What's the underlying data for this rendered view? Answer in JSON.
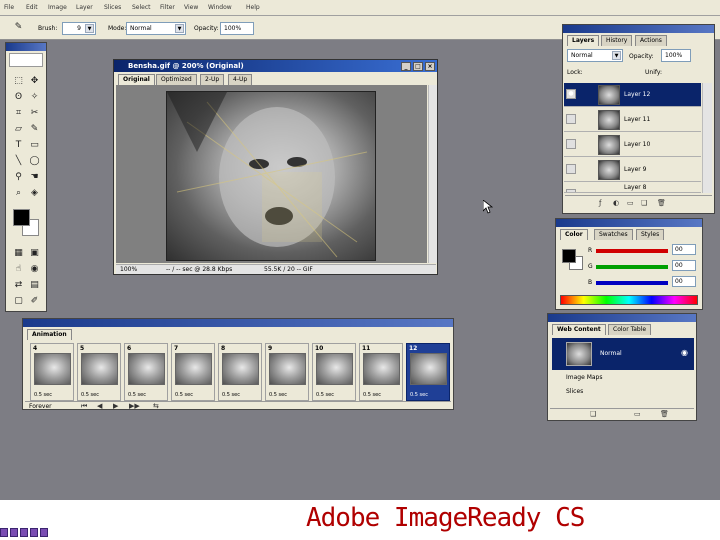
{
  "menu": [
    "File",
    "Edit",
    "Image",
    "Layer",
    "Slices",
    "Select",
    "Filter",
    "View",
    "Window",
    "Help"
  ],
  "options_bar": {
    "brush_label": "Brush:",
    "brush_size": "9",
    "mode_label": "Mode:",
    "mode_value": "Normal",
    "opacity_label": "Opacity:",
    "opacity_value": "100%"
  },
  "document": {
    "title": "Bensha.gif @ 200% (Original)",
    "tabs": [
      "Original",
      "Optimized",
      "2-Up",
      "4-Up"
    ],
    "zoom": "100%",
    "status_1": "-- / -- sec @ 28.8 Kbps",
    "status_2": "55.5K / 20 -- GIF"
  },
  "layers_panel": {
    "tabs": [
      "Layers",
      "History",
      "Actions"
    ],
    "blend_mode": "Normal",
    "opacity_label": "Opacity:",
    "opacity_value": "100%",
    "lock_label": "Lock:",
    "unify_label": "Unify:",
    "layers": [
      {
        "name": "Layer 12",
        "selected": true
      },
      {
        "name": "Layer 11",
        "selected": false
      },
      {
        "name": "Layer 10",
        "selected": false
      },
      {
        "name": "Layer 9",
        "selected": false
      },
      {
        "name": "Layer 8",
        "selected": false
      }
    ]
  },
  "color_panel": {
    "tabs": [
      "Color",
      "Swatches",
      "Styles"
    ],
    "channels": [
      {
        "label": "R",
        "value": "00",
        "color": "#d00000"
      },
      {
        "label": "G",
        "value": "00",
        "color": "#00a000"
      },
      {
        "label": "B",
        "value": "00",
        "color": "#0000c0"
      }
    ]
  },
  "animation_panel": {
    "title": "Animation",
    "loop": "Forever",
    "frames": [
      {
        "num": "4",
        "delay": "0.5 sec",
        "selected": false
      },
      {
        "num": "5",
        "delay": "0.5 sec",
        "selected": false
      },
      {
        "num": "6",
        "delay": "0.5 sec",
        "selected": false
      },
      {
        "num": "7",
        "delay": "0.5 sec",
        "selected": false
      },
      {
        "num": "8",
        "delay": "0.5 sec",
        "selected": false
      },
      {
        "num": "9",
        "delay": "0.5 sec",
        "selected": false
      },
      {
        "num": "10",
        "delay": "0.5 sec",
        "selected": false
      },
      {
        "num": "11",
        "delay": "0.5 sec",
        "selected": false
      },
      {
        "num": "12",
        "delay": "0.5 sec",
        "selected": true
      }
    ]
  },
  "web_content_panel": {
    "tabs": [
      "Web Content",
      "Color Table"
    ],
    "items": [
      "Normal",
      "Image Maps",
      "Slices"
    ]
  },
  "caption": "Adobe ImageReady CS",
  "colors": {
    "workspace": "#7d7d84",
    "title_blue": "#0a246a",
    "panel_bg": "#ece9d8",
    "caption": "#b00000"
  }
}
